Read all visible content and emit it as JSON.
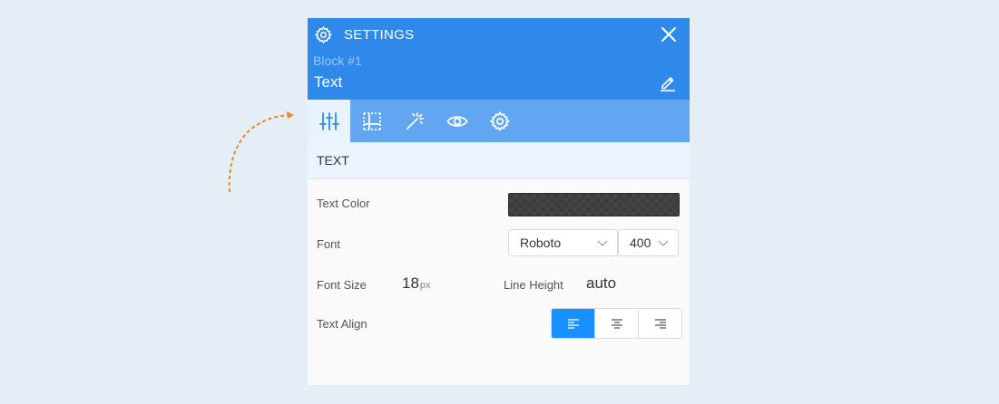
{
  "header": {
    "title": "SETTINGS",
    "subtitle": "Block #1",
    "name": "Text",
    "icons": {
      "settings": "gear-icon",
      "close": "close-icon",
      "edit": "pencil-icon"
    }
  },
  "tabs": [
    {
      "id": "style",
      "icon": "sliders-icon",
      "active": true
    },
    {
      "id": "layout",
      "icon": "grid-icon",
      "active": false
    },
    {
      "id": "effects",
      "icon": "magic-wand-icon",
      "active": false
    },
    {
      "id": "visibility",
      "icon": "eye-icon",
      "active": false
    },
    {
      "id": "advanced",
      "icon": "gear-icon",
      "active": false
    }
  ],
  "section": {
    "title": "TEXT"
  },
  "fields": {
    "text_color": {
      "label": "Text Color",
      "value": "#3c3c3c"
    },
    "font": {
      "label": "Font",
      "family": "Roboto",
      "weight": "400"
    },
    "font_size": {
      "label": "Font Size",
      "value": "18",
      "unit": "px"
    },
    "line_height": {
      "label": "Line Height",
      "value": "auto"
    },
    "text_align": {
      "label": "Text Align",
      "options": [
        "left",
        "center",
        "right"
      ],
      "selected": "left"
    }
  },
  "colors": {
    "header": "#2e89ea",
    "tabs": "#62a5f0",
    "accent": "#1890ff",
    "arrow": "#e8892c"
  }
}
